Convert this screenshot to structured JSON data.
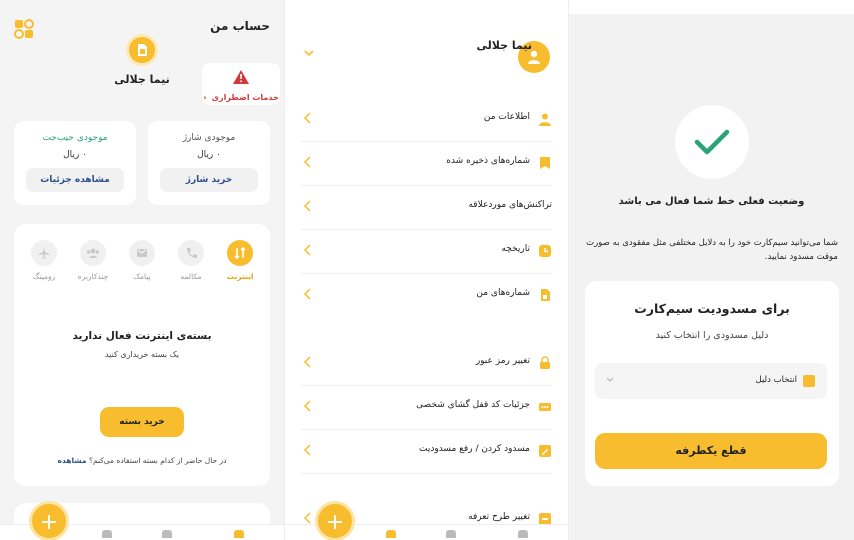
{
  "account": {
    "title": "حساب من",
    "user_name": "نیما جلالی",
    "emergency_label": "خدمات اضطراری",
    "charge_card": {
      "title": "موجودی شارژ",
      "value": "۰ ریال",
      "button": "خرید شارژ"
    },
    "wallet_card": {
      "title": "موجودی جیب‌جت",
      "value": "۰ ریال",
      "button": "مشاهده جزئیات"
    },
    "services": [
      {
        "label": "اینترنت",
        "icon": "internet-icon",
        "active": true
      },
      {
        "label": "مکالمه",
        "icon": "phone-icon",
        "active": false
      },
      {
        "label": "پیامک",
        "icon": "sms-icon",
        "active": false
      },
      {
        "label": "چندکاربره",
        "icon": "multiuser-icon",
        "active": false
      },
      {
        "label": "رومینگ",
        "icon": "plane-icon",
        "active": false
      }
    ],
    "no_package_title": "بسته‌ی اینترنت فعال ندارید",
    "no_package_sub": "یک بسته خریداری کنید",
    "buy_package": "خرید بسته",
    "using_question": "در حال حاضر از کدام بسته استفاده می‌کنم؟",
    "view_link": "مشاهده"
  },
  "menu": {
    "user_name": "نیما جلالی",
    "items": [
      {
        "label": "اطلاعات من",
        "icon": "person-icon"
      },
      {
        "label": "شماره‌های ذخیره شده",
        "icon": "bookmark-icon"
      },
      {
        "label": "تراکنش‌های موردعلاقه",
        "icon": ""
      },
      {
        "label": "تاریخچه",
        "icon": "history-icon"
      },
      {
        "label": "شماره‌های من",
        "icon": "sim-icon"
      },
      {
        "label": "تغییر رمز عبور",
        "icon": "lock-icon"
      },
      {
        "label": "جزئیات کد قفل گشای شخصی",
        "icon": "puk-icon"
      },
      {
        "label": "مسدود کردن / رفع مسدودیت",
        "icon": "edit-icon"
      },
      {
        "label": "تغییر طرح تعرفه",
        "icon": "tariff-icon"
      }
    ]
  },
  "block": {
    "status": "وضعیت فعلی خط شما فعال می باشد",
    "description": "شما می‌توانید سیم‌کارت خود را به دلایل مختلفی مثل مفقودی به صورت موقت مسدود نمایید.",
    "card_title": "برای مسدودیت سیم‌کارت",
    "card_sub": "دلیل مسدودی را انتخاب کنید",
    "select_placeholder": "انتخاب دلیل",
    "cut_button": "قطع یکطرفه"
  },
  "colors": {
    "accent": "#f7bd2f",
    "link": "#2c4f8e",
    "success": "#2aa37a",
    "danger": "#d13a3a"
  }
}
